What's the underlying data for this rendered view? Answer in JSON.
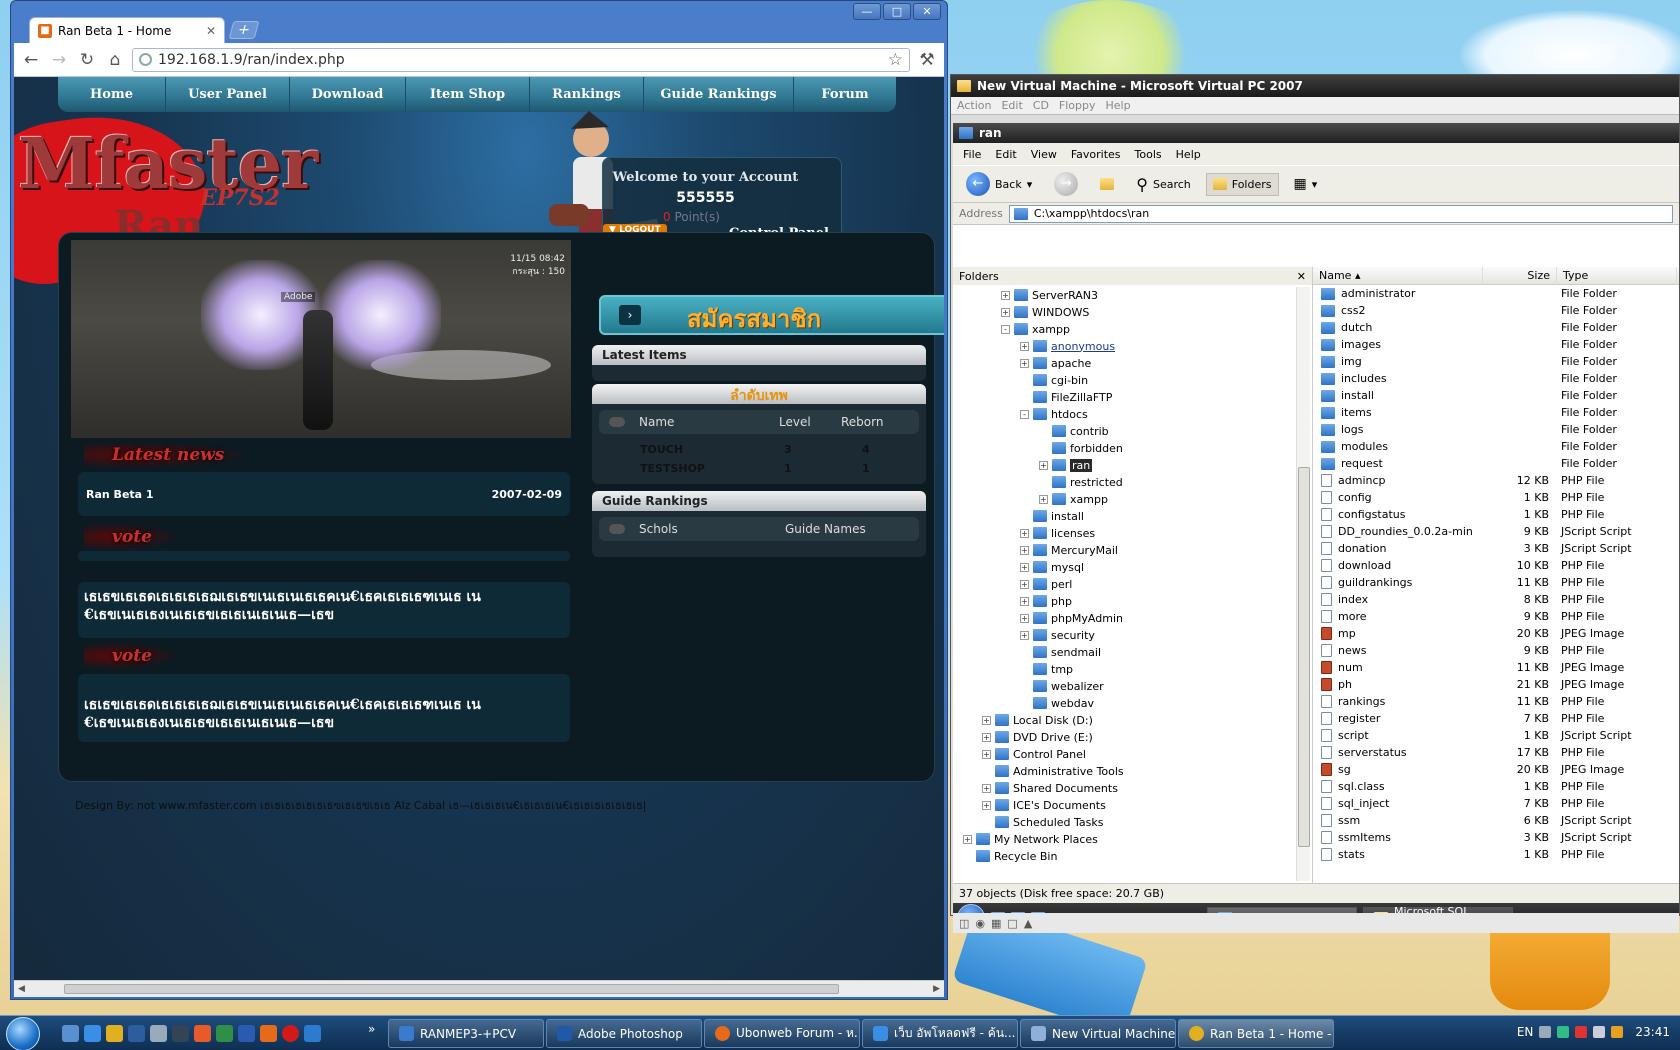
{
  "chrome": {
    "tab_title": "Ran Beta 1 - Home",
    "url": "192.168.1.9/ran/index.php"
  },
  "site": {
    "nav": [
      "Home",
      "User Panel",
      "Download",
      "Item Shop",
      "Rankings",
      "Guide Rankings",
      "Forum"
    ],
    "logo": "Mfaster",
    "logo_sub": "EP7S2",
    "logo_ran": "Ran",
    "welcome": "Welcome to your Account",
    "username": "555555",
    "points_value": "0",
    "points_label": "Point(s)",
    "logout": "LOGOUT",
    "control_panel": "Control Panel",
    "screenshot_hud": "11/15 08:42",
    "screenshot_hud2": "กระสุน : 150",
    "screenshot_tag": "Adobe",
    "latest_news_heading": "Latest news",
    "news_title": "Ran Beta 1",
    "news_date": "2007-02-09",
    "vote_heading": "vote",
    "vote_text_line1": "เธเธขเธเธดเธเธเธเธฌเธเธขเนเธเนเธเธคเน€เธคเธเธเธฑเนเธ เน",
    "vote_text_line2": "€เธขเนเธเธงเนเธเธขเธเธเนเธเนเธ—เธข",
    "register": "สมัครสมาชิก",
    "latest_items": "Latest Items",
    "rank_title": "ลำดับเทพ",
    "rank_headers": [
      "Name",
      "Level",
      "Reborn"
    ],
    "rank_rows": [
      [
        "TOUCH",
        "3",
        "4"
      ],
      [
        "TESTSHOP",
        "1",
        "1"
      ]
    ],
    "guide_title": "Guide Rankings",
    "guide_headers": [
      "Schols",
      "Guide Names"
    ],
    "footer": "Design By: not www.mfaster.com เธเธเธเธเธเธเธฃเธเธขเธเธ Alz Cabal เธ—เธเธเธเน€เธเธเธเน€เธเธเธเธเธเธเธ|"
  },
  "vpc": {
    "title": "New Virtual Machine - Microsoft Virtual PC 2007",
    "menu": [
      "Action",
      "Edit",
      "CD",
      "Floppy",
      "Help"
    ],
    "explorer_title": "ran",
    "explorer_menu": [
      "File",
      "Edit",
      "View",
      "Favorites",
      "Tools",
      "Help"
    ],
    "back": "Back",
    "search": "Search",
    "folders": "Folders",
    "address_label": "Address",
    "address": "C:\\xampp\\htdocs\\ran",
    "folders_pane": "Folders",
    "tree": [
      {
        "label": "ServerRAN3",
        "indent": 2,
        "exp": "+"
      },
      {
        "label": "WINDOWS",
        "indent": 2,
        "exp": "+"
      },
      {
        "label": "xampp",
        "indent": 2,
        "exp": "-"
      },
      {
        "label": "anonymous",
        "indent": 3,
        "exp": "+",
        "link": true
      },
      {
        "label": "apache",
        "indent": 3,
        "exp": "+"
      },
      {
        "label": "cgi-bin",
        "indent": 3,
        "exp": ""
      },
      {
        "label": "FileZillaFTP",
        "indent": 3,
        "exp": ""
      },
      {
        "label": "htdocs",
        "indent": 3,
        "exp": "-"
      },
      {
        "label": "contrib",
        "indent": 4,
        "exp": ""
      },
      {
        "label": "forbidden",
        "indent": 4,
        "exp": ""
      },
      {
        "label": "ran",
        "indent": 4,
        "exp": "+",
        "selected": true
      },
      {
        "label": "restricted",
        "indent": 4,
        "exp": ""
      },
      {
        "label": "xampp",
        "indent": 4,
        "exp": "+"
      },
      {
        "label": "install",
        "indent": 3,
        "exp": ""
      },
      {
        "label": "licenses",
        "indent": 3,
        "exp": "+"
      },
      {
        "label": "MercuryMail",
        "indent": 3,
        "exp": "+"
      },
      {
        "label": "mysql",
        "indent": 3,
        "exp": "+"
      },
      {
        "label": "perl",
        "indent": 3,
        "exp": "+"
      },
      {
        "label": "php",
        "indent": 3,
        "exp": "+"
      },
      {
        "label": "phpMyAdmin",
        "indent": 3,
        "exp": "+"
      },
      {
        "label": "security",
        "indent": 3,
        "exp": "+"
      },
      {
        "label": "sendmail",
        "indent": 3,
        "exp": ""
      },
      {
        "label": "tmp",
        "indent": 3,
        "exp": ""
      },
      {
        "label": "webalizer",
        "indent": 3,
        "exp": ""
      },
      {
        "label": "webdav",
        "indent": 3,
        "exp": ""
      },
      {
        "label": "Local Disk (D:)",
        "indent": 1,
        "exp": "+"
      },
      {
        "label": "DVD Drive (E:)",
        "indent": 1,
        "exp": "+"
      },
      {
        "label": "Control Panel",
        "indent": 1,
        "exp": "+"
      },
      {
        "label": "Administrative Tools",
        "indent": 1,
        "exp": ""
      },
      {
        "label": "Shared Documents",
        "indent": 1,
        "exp": "+"
      },
      {
        "label": "ICE's Documents",
        "indent": 1,
        "exp": "+"
      },
      {
        "label": "Scheduled Tasks",
        "indent": 1,
        "exp": ""
      },
      {
        "label": "My Network Places",
        "indent": 0,
        "exp": "+"
      },
      {
        "label": "Recycle Bin",
        "indent": 0,
        "exp": ""
      }
    ],
    "list_headers": [
      "Name",
      "Size",
      "Type"
    ],
    "files": [
      [
        "administrator",
        "",
        "File Folder",
        "folder"
      ],
      [
        "css2",
        "",
        "File Folder",
        "folder"
      ],
      [
        "dutch",
        "",
        "File Folder",
        "folder"
      ],
      [
        "images",
        "",
        "File Folder",
        "folder"
      ],
      [
        "img",
        "",
        "File Folder",
        "folder"
      ],
      [
        "includes",
        "",
        "File Folder",
        "folder"
      ],
      [
        "install",
        "",
        "File Folder",
        "folder"
      ],
      [
        "items",
        "",
        "File Folder",
        "folder"
      ],
      [
        "logs",
        "",
        "File Folder",
        "folder"
      ],
      [
        "modules",
        "",
        "File Folder",
        "folder"
      ],
      [
        "request",
        "",
        "File Folder",
        "folder"
      ],
      [
        "admincp",
        "12 KB",
        "PHP File",
        "file"
      ],
      [
        "config",
        "1 KB",
        "PHP File",
        "file"
      ],
      [
        "configstatus",
        "1 KB",
        "PHP File",
        "file"
      ],
      [
        "DD_roundies_0.0.2a-min",
        "9 KB",
        "JScript Script",
        "file"
      ],
      [
        "donation",
        "3 KB",
        "JScript Script",
        "file"
      ],
      [
        "download",
        "10 KB",
        "PHP File",
        "file"
      ],
      [
        "guildrankings",
        "11 KB",
        "PHP File",
        "file"
      ],
      [
        "index",
        "8 KB",
        "PHP File",
        "file"
      ],
      [
        "more",
        "9 KB",
        "PHP File",
        "file"
      ],
      [
        "mp",
        "20 KB",
        "JPEG Image",
        "img"
      ],
      [
        "news",
        "9 KB",
        "PHP File",
        "file"
      ],
      [
        "num",
        "11 KB",
        "JPEG Image",
        "img"
      ],
      [
        "ph",
        "21 KB",
        "JPEG Image",
        "img"
      ],
      [
        "rankings",
        "11 KB",
        "PHP File",
        "file"
      ],
      [
        "register",
        "7 KB",
        "PHP File",
        "file"
      ],
      [
        "script",
        "1 KB",
        "JScript Script",
        "file"
      ],
      [
        "serverstatus",
        "17 KB",
        "PHP File",
        "file"
      ],
      [
        "sg",
        "20 KB",
        "JPEG Image",
        "img"
      ],
      [
        "sql.class",
        "1 KB",
        "PHP File",
        "file"
      ],
      [
        "sql_inject",
        "7 KB",
        "PHP File",
        "file"
      ],
      [
        "ssm",
        "6 KB",
        "JScript Script",
        "file"
      ],
      [
        "ssmItems",
        "3 KB",
        "JScript Script",
        "file"
      ],
      [
        "stats",
        "1 KB",
        "PHP File",
        "file"
      ]
    ],
    "status": "37 objects (Disk free space: 20.7 GB)",
    "guest_tasks": [
      "ran",
      "Microsoft SQL Serve..."
    ]
  },
  "taskbar": {
    "tasks": [
      "RANMEP3-+PCV",
      "Adobe Photoshop",
      "Ubonweb Forum - ห...",
      "เว็บ อัพโหลดฟรี - ค้น...",
      "New Virtual Machine ...",
      "Ran Beta 1 - Home - ..."
    ],
    "lang": "EN",
    "clock": "23:41"
  },
  "colors": {
    "site_bg": "#16344f",
    "nav_bg": "#2f7691",
    "register_text": "#ffb02e",
    "taskbar": "#163d66"
  }
}
